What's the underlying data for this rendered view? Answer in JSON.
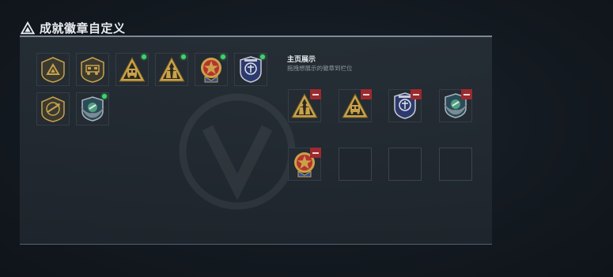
{
  "header": {
    "title": "成就徽章自定义",
    "icon": "warning-triangle-icon"
  },
  "display": {
    "title": "主页展示",
    "subtitle": "拖拽想展示的徽章到栏位"
  },
  "badge_grid": [
    {
      "icon": "triangle-shield-badge-icon",
      "new": false
    },
    {
      "icon": "vehicle-shield-badge-icon",
      "new": false
    },
    {
      "icon": "vehicle-triangle-badge-icon",
      "new": true
    },
    {
      "icon": "soldiers-triangle-badge-icon",
      "new": true
    },
    {
      "icon": "red-star-medal-icon",
      "new": true
    },
    {
      "icon": "police-badge-icon",
      "new": true
    },
    {
      "icon": "bird-shield-badge-icon",
      "new": false
    },
    {
      "icon": "wings-shield-badge-icon",
      "new": true
    }
  ],
  "showcase_slots": [
    {
      "icon": "soldiers-triangle-badge-icon",
      "filled": true
    },
    {
      "icon": "vehicle-triangle-badge-icon",
      "filled": true
    },
    {
      "icon": "police-badge-icon",
      "filled": true
    },
    {
      "icon": "wings-shield-badge-icon",
      "filled": true
    },
    {
      "icon": "red-star-medal-icon",
      "filled": true
    },
    {
      "icon": "",
      "filled": false
    },
    {
      "icon": "",
      "filled": false
    },
    {
      "icon": "",
      "filled": false
    }
  ]
}
